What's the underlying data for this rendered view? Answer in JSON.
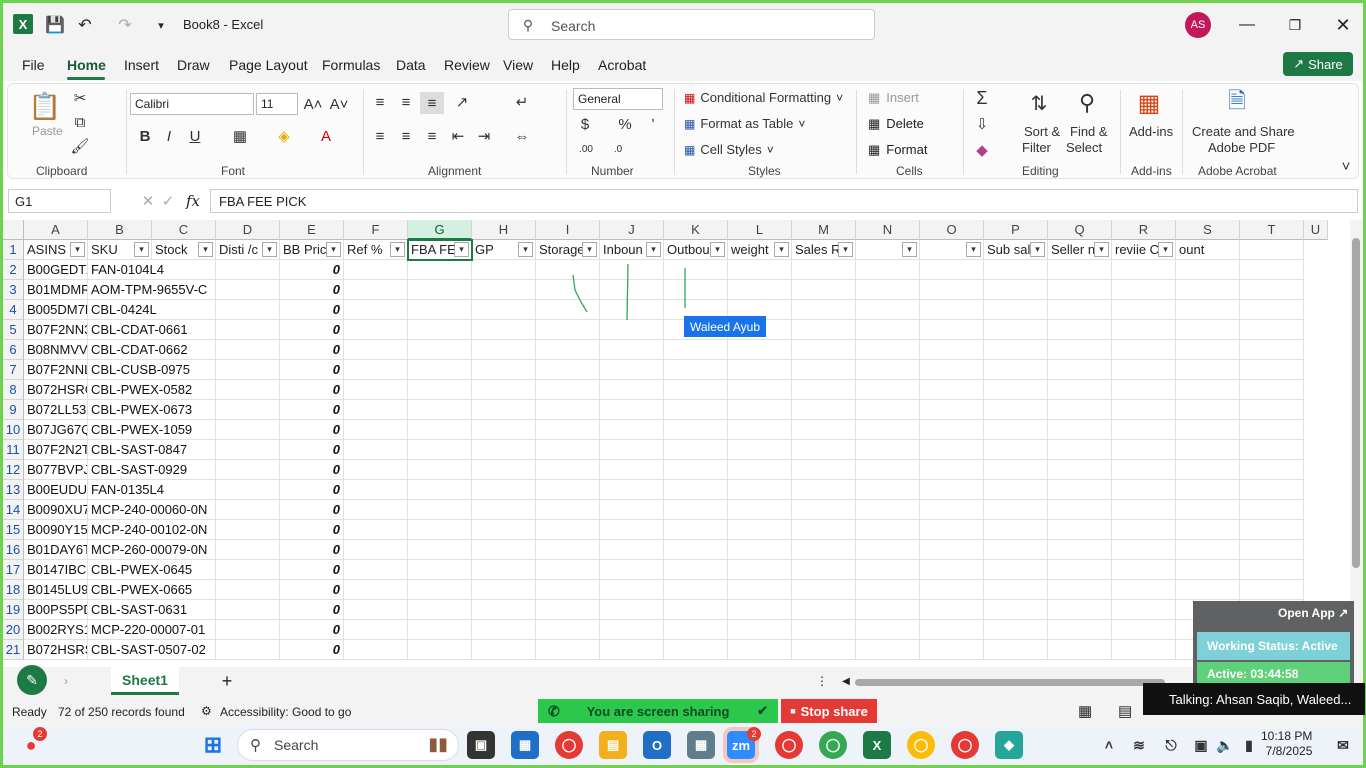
{
  "titlebar": {
    "doc_title": "Book8  -  Excel",
    "search_placeholder": "Search",
    "avatar_initials": "AS"
  },
  "menu": {
    "items": [
      "File",
      "Home",
      "Insert",
      "Draw",
      "Page Layout",
      "Formulas",
      "Data",
      "Review",
      "View",
      "Help",
      "Acrobat"
    ],
    "active": "Home",
    "share_label": "Share"
  },
  "ribbon": {
    "clipboard": {
      "paste_label": "Paste",
      "group_label": "Clipboard"
    },
    "font": {
      "family": "Calibri",
      "size": "11",
      "group_label": "Font"
    },
    "alignment": {
      "group_label": "Alignment"
    },
    "number": {
      "format": "General",
      "group_label": "Number"
    },
    "styles": {
      "conditional": "Conditional Formatting",
      "format_table": "Format as Table",
      "cell_styles": "Cell Styles",
      "group_label": "Styles"
    },
    "cells": {
      "insert": "Insert",
      "delete": "Delete",
      "format": "Format",
      "group_label": "Cells"
    },
    "editing": {
      "sort_filter": "Sort &",
      "sort_filter2": "Filter",
      "find_select": "Find &",
      "find_select2": "Select",
      "group_label": "Editing"
    },
    "addins": {
      "label": "Add-ins",
      "group_label": "Add-ins"
    },
    "acrobat": {
      "label": "Create and Share",
      "label2": "Adobe PDF",
      "group_label": "Adobe Acrobat"
    }
  },
  "formula_bar": {
    "name_box": "G1",
    "formula": "FBA FEE PICK"
  },
  "columns": [
    "A",
    "B",
    "C",
    "D",
    "E",
    "F",
    "G",
    "H",
    "I",
    "J",
    "K",
    "L",
    "M",
    "N",
    "O",
    "P",
    "Q",
    "R",
    "S",
    "T",
    "U"
  ],
  "header_row": [
    "ASINS",
    "SKU",
    "Stock",
    "Disti /c",
    "BB Pric",
    "Ref %",
    "FBA FEE",
    "GP",
    "Storage",
    "Inboun",
    "Outbou",
    "weight",
    "Sales R",
    "",
    "",
    "Sub sal",
    "Seller n",
    "reviie C",
    "ount"
  ],
  "rows": [
    {
      "n": "2",
      "a": "B00GEDTZ",
      "b": "FAN-0104L4",
      "e": "0"
    },
    {
      "n": "3",
      "a": "B01MDMR",
      "b": "AOM-TPM-9655V-C",
      "e": "0"
    },
    {
      "n": "4",
      "a": "B005DM7I",
      "b": "CBL-0424L",
      "e": "0"
    },
    {
      "n": "5",
      "a": "B07F2NN3",
      "b": "CBL-CDAT-0661",
      "e": "0"
    },
    {
      "n": "6",
      "a": "B08NMVV",
      "b": "CBL-CDAT-0662",
      "e": "0"
    },
    {
      "n": "7",
      "a": "B07F2NNL",
      "b": "CBL-CUSB-0975",
      "e": "0"
    },
    {
      "n": "8",
      "a": "B072HSRC",
      "b": "CBL-PWEX-0582",
      "e": "0"
    },
    {
      "n": "9",
      "a": "B072LL53F",
      "b": "CBL-PWEX-0673",
      "e": "0"
    },
    {
      "n": "10",
      "a": "B07JG67Q",
      "b": "CBL-PWEX-1059",
      "e": "0"
    },
    {
      "n": "11",
      "a": "B07F2N2T",
      "b": "CBL-SAST-0847",
      "e": "0"
    },
    {
      "n": "12",
      "a": "B077BVPJ",
      "b": "CBL-SAST-0929",
      "e": "0"
    },
    {
      "n": "13",
      "a": "B00EUDUC",
      "b": "FAN-0135L4",
      "e": "0"
    },
    {
      "n": "14",
      "a": "B0090XU7",
      "b": "MCP-240-00060-0N",
      "e": "0"
    },
    {
      "n": "15",
      "a": "B0090Y15",
      "b": "MCP-240-00102-0N",
      "e": "0"
    },
    {
      "n": "16",
      "a": "B01DAY6T",
      "b": "MCP-260-00079-0N",
      "e": "0"
    },
    {
      "n": "17",
      "a": "B0147IBC1",
      "b": "CBL-PWEX-0645",
      "e": "0"
    },
    {
      "n": "18",
      "a": "B0145LU9",
      "b": "CBL-PWEX-0665",
      "e": "0"
    },
    {
      "n": "19",
      "a": "B00PS5PD",
      "b": "CBL-SAST-0631",
      "e": "0"
    },
    {
      "n": "20",
      "a": "B002RYS1",
      "b": "MCP-220-00007-01",
      "e": "0"
    },
    {
      "n": "21",
      "a": "B072HSRS",
      "b": "CBL-SAST-0507-02",
      "e": "0"
    }
  ],
  "annotation_tooltip": "Waleed Ayub",
  "sheet": {
    "tab": "Sheet1"
  },
  "status": {
    "ready": "Ready",
    "records": "72 of 250 records found",
    "accessibility": "Accessibility: Good to go",
    "sharing": "You are screen sharing",
    "stop_share": "Stop share",
    "talking": "Talking: Ahsan Saqib, Waleed..."
  },
  "overlay": {
    "open_app": "Open App",
    "working_status": "Working Status: Active",
    "active_timer": "Active: 03:44:58"
  },
  "taskbar": {
    "search": "Search",
    "time": "10:18 PM",
    "date": "7/8/2025",
    "notif_count": "2",
    "zm_badge": "2"
  },
  "colors": {
    "excel_green": "#1d7a44",
    "screen_share_green": "#2cc84d",
    "stop_red": "#e53935"
  }
}
